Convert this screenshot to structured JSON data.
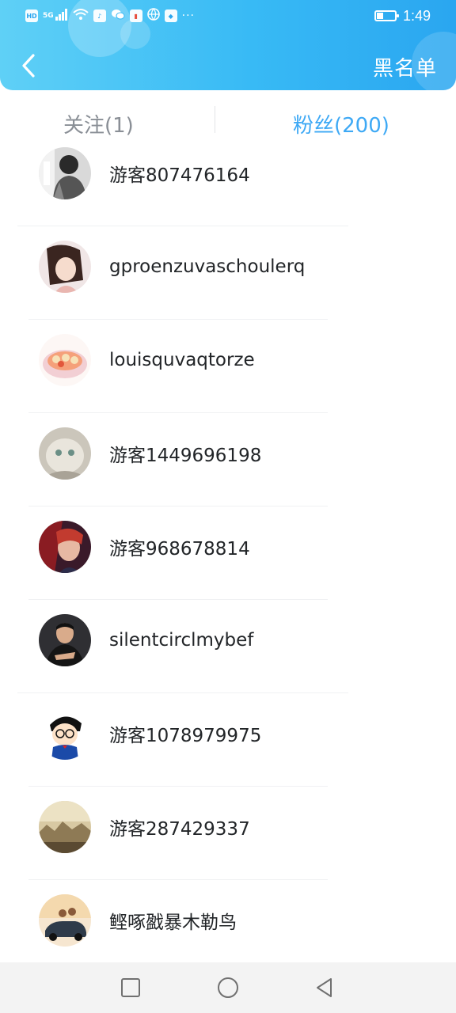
{
  "status_bar": {
    "network_badge": "HD",
    "network_type": "5G",
    "more_indicator": "···",
    "time": "1:49",
    "battery_level": 0.35
  },
  "header": {
    "back_icon": "chevron-left-icon",
    "blacklist_label": "黑名单"
  },
  "tabs": [
    {
      "label": "关注(1)",
      "active": false
    },
    {
      "label": "粉丝(200)",
      "active": true
    }
  ],
  "colors": {
    "header_start": "#5fd0f6",
    "header_end": "#2aa6f0",
    "active_tab": "#3ea9f5",
    "inactive_tab": "#8a8f96"
  },
  "followers": [
    {
      "name": "游客807476164",
      "avatar": "avatar-grayscale-person"
    },
    {
      "name": "gproenzuvaschoulerq",
      "avatar": "avatar-girl-portrait"
    },
    {
      "name": "louisquvaqtorze",
      "avatar": "avatar-food-bowl"
    },
    {
      "name": "游客1449696198",
      "avatar": "avatar-fluffy-cat"
    },
    {
      "name": "游客968678814",
      "avatar": "avatar-game-character"
    },
    {
      "name": "silentcirclmybef",
      "avatar": "avatar-man-dark-suit"
    },
    {
      "name": "游客1078979975",
      "avatar": "avatar-cartoon-detective"
    },
    {
      "name": "游客287429337",
      "avatar": "avatar-vintage-landscape"
    },
    {
      "name": "鲣啄戤暴木勒鸟",
      "avatar": "avatar-car-sunset"
    }
  ],
  "nav_bar": {
    "recents_icon": "square-icon",
    "home_icon": "circle-icon",
    "back_icon": "triangle-back-icon"
  }
}
